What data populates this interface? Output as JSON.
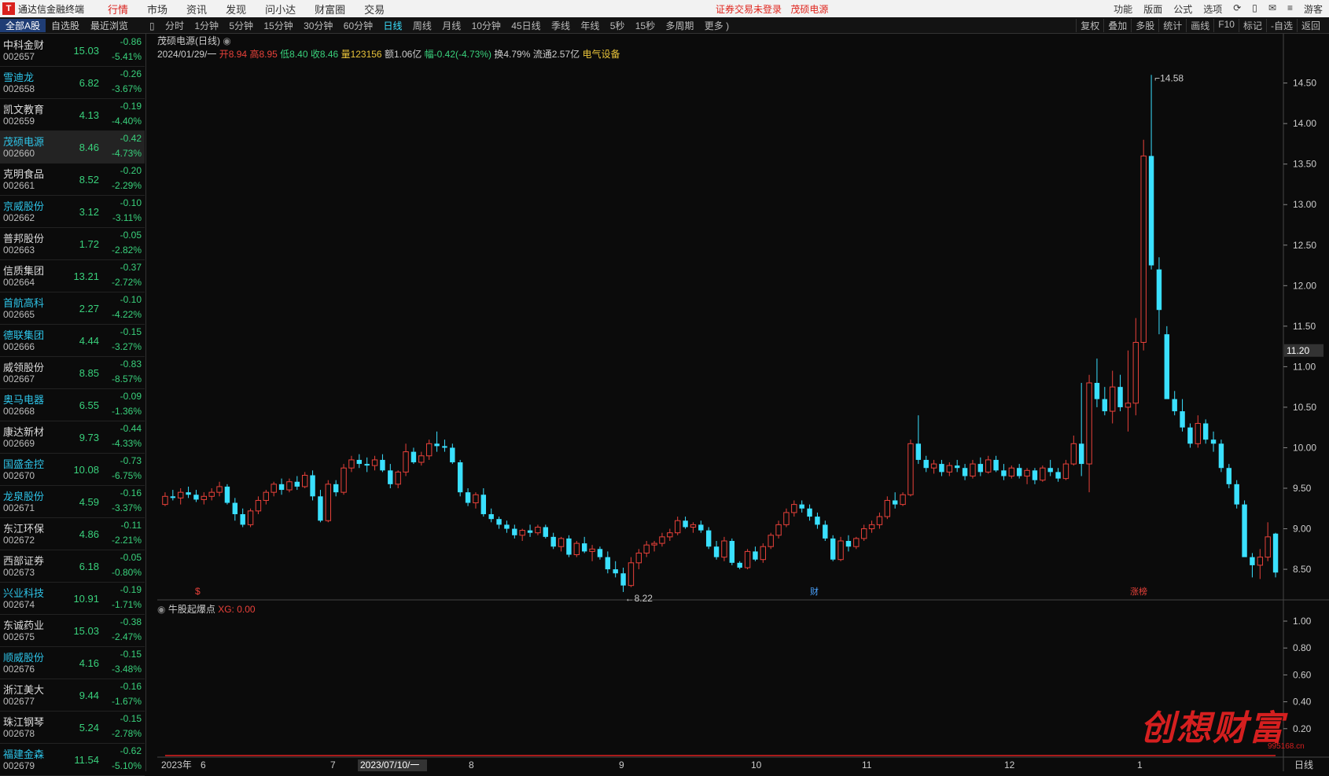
{
  "app": {
    "title": "通达信金融终端",
    "logo": "T"
  },
  "menu": [
    "行情",
    "市场",
    "资讯",
    "发现",
    "问小达",
    "财富圈",
    "交易"
  ],
  "notice": [
    "证券交易未登录",
    "茂硕电源"
  ],
  "topright": [
    "功能",
    "版面",
    "公式",
    "选项",
    "游客"
  ],
  "lefttabs": [
    "全部A股",
    "自选股",
    "最近浏览"
  ],
  "periods": [
    "分时",
    "1分钟",
    "5分钟",
    "15分钟",
    "30分钟",
    "60分钟",
    "日线",
    "周线",
    "月线",
    "10分钟",
    "45日线",
    "季线",
    "年线",
    "5秒",
    "15秒",
    "多周期",
    "更多 )"
  ],
  "righttools": [
    "复权",
    "叠加",
    "多股",
    "统计",
    "画线",
    "F10",
    "标记",
    "-自选",
    "返回"
  ],
  "stocks": [
    {
      "name": "中科金财",
      "code": "002657",
      "price": "15.03",
      "chg": "-0.86",
      "pct": "-5.41%",
      "blue": false
    },
    {
      "name": "雪迪龙",
      "code": "002658",
      "price": "6.82",
      "chg": "-0.26",
      "pct": "-3.67%",
      "blue": true
    },
    {
      "name": "凯文教育",
      "code": "002659",
      "price": "4.13",
      "chg": "-0.19",
      "pct": "-4.40%",
      "blue": false
    },
    {
      "name": "茂硕电源",
      "code": "002660",
      "price": "8.46",
      "chg": "-0.42",
      "pct": "-4.73%",
      "blue": true
    },
    {
      "name": "克明食品",
      "code": "002661",
      "price": "8.52",
      "chg": "-0.20",
      "pct": "-2.29%",
      "blue": false
    },
    {
      "name": "京威股份",
      "code": "002662",
      "price": "3.12",
      "chg": "-0.10",
      "pct": "-3.11%",
      "blue": true
    },
    {
      "name": "普邦股份",
      "code": "002663",
      "price": "1.72",
      "chg": "-0.05",
      "pct": "-2.82%",
      "blue": false
    },
    {
      "name": "信质集团",
      "code": "002664",
      "price": "13.21",
      "chg": "-0.37",
      "pct": "-2.72%",
      "blue": false
    },
    {
      "name": "首航高科",
      "code": "002665",
      "price": "2.27",
      "chg": "-0.10",
      "pct": "-4.22%",
      "blue": true
    },
    {
      "name": "德联集团",
      "code": "002666",
      "price": "4.44",
      "chg": "-0.15",
      "pct": "-3.27%",
      "blue": true
    },
    {
      "name": "威领股份",
      "code": "002667",
      "price": "8.85",
      "chg": "-0.83",
      "pct": "-8.57%",
      "blue": false
    },
    {
      "name": "奥马电器",
      "code": "002668",
      "price": "6.55",
      "chg": "-0.09",
      "pct": "-1.36%",
      "blue": true
    },
    {
      "name": "康达新材",
      "code": "002669",
      "price": "9.73",
      "chg": "-0.44",
      "pct": "-4.33%",
      "blue": false
    },
    {
      "name": "国盛金控",
      "code": "002670",
      "price": "10.08",
      "chg": "-0.73",
      "pct": "-6.75%",
      "blue": true
    },
    {
      "name": "龙泉股份",
      "code": "002671",
      "price": "4.59",
      "chg": "-0.16",
      "pct": "-3.37%",
      "blue": true
    },
    {
      "name": "东江环保",
      "code": "002672",
      "price": "4.86",
      "chg": "-0.11",
      "pct": "-2.21%",
      "blue": false
    },
    {
      "name": "西部证券",
      "code": "002673",
      "price": "6.18",
      "chg": "-0.05",
      "pct": "-0.80%",
      "blue": false
    },
    {
      "name": "兴业科技",
      "code": "002674",
      "price": "10.91",
      "chg": "-0.19",
      "pct": "-1.71%",
      "blue": true
    },
    {
      "name": "东诚药业",
      "code": "002675",
      "price": "15.03",
      "chg": "-0.38",
      "pct": "-2.47%",
      "blue": false
    },
    {
      "name": "顺威股份",
      "code": "002676",
      "price": "4.16",
      "chg": "-0.15",
      "pct": "-3.48%",
      "blue": true
    },
    {
      "name": "浙江美大",
      "code": "002677",
      "price": "9.44",
      "chg": "-0.16",
      "pct": "-1.67%",
      "blue": false
    },
    {
      "name": "珠江钢琴",
      "code": "002678",
      "price": "5.24",
      "chg": "-0.15",
      "pct": "-2.78%",
      "blue": false
    },
    {
      "name": "福建金森",
      "code": "002679",
      "price": "11.54",
      "chg": "-0.62",
      "pct": "-5.10%",
      "blue": true
    }
  ],
  "chart": {
    "title": "茂硕电源(日线)",
    "info": {
      "date": "2024/01/29/一",
      "open": "开8.94",
      "high": "高8.95",
      "low": "低8.40",
      "close": "收8.46",
      "vol": "量123156",
      "amt": "额1.06亿",
      "range": "幅-0.42(-4.73%)",
      "turn": "换4.79%",
      "float": "流通2.57亿",
      "sector": "电气设备"
    },
    "indicator": {
      "name": "牛股起爆点",
      "value": "XG: 0.00"
    },
    "high_label": "14.58",
    "low_label": "8.22",
    "cursor_price": "11.20",
    "markers": [
      "$",
      "财",
      "涨榜"
    ],
    "date_cursor": "2023/07/10/一"
  },
  "chart_data": {
    "type": "candlestick",
    "yticks": [
      "14.50",
      "14.00",
      "13.50",
      "13.00",
      "12.50",
      "12.00",
      "11.50",
      "11.00",
      "10.50",
      "10.00",
      "9.50",
      "9.00",
      "8.50"
    ],
    "ylim": [
      8.2,
      14.7
    ],
    "xlabels": [
      "2023年",
      "6",
      "7",
      "8",
      "9",
      "10",
      "11",
      "12",
      "1",
      "日线"
    ],
    "indicator_yticks": [
      "1.00",
      "0.80",
      "0.60",
      "0.40",
      "0.20"
    ],
    "indicator_values": [
      [
        171,
        1
      ],
      [
        177,
        1
      ],
      [
        197,
        1
      ]
    ],
    "ohlc": [
      [
        9.3,
        9.45,
        9.28,
        9.4
      ],
      [
        9.4,
        9.48,
        9.35,
        9.38
      ],
      [
        9.38,
        9.5,
        9.3,
        9.45
      ],
      [
        9.45,
        9.52,
        9.38,
        9.42
      ],
      [
        9.42,
        9.48,
        9.33,
        9.36
      ],
      [
        9.36,
        9.45,
        9.3,
        9.4
      ],
      [
        9.4,
        9.5,
        9.35,
        9.45
      ],
      [
        9.45,
        9.58,
        9.4,
        9.52
      ],
      [
        9.52,
        9.55,
        9.3,
        9.32
      ],
      [
        9.32,
        9.38,
        9.1,
        9.18
      ],
      [
        9.18,
        9.25,
        9.02,
        9.05
      ],
      [
        9.05,
        9.25,
        9.02,
        9.22
      ],
      [
        9.22,
        9.4,
        9.18,
        9.35
      ],
      [
        9.35,
        9.48,
        9.3,
        9.45
      ],
      [
        9.45,
        9.58,
        9.4,
        9.55
      ],
      [
        9.55,
        9.62,
        9.42,
        9.48
      ],
      [
        9.48,
        9.62,
        9.45,
        9.58
      ],
      [
        9.58,
        9.65,
        9.48,
        9.52
      ],
      [
        9.52,
        9.7,
        9.5,
        9.66
      ],
      [
        9.66,
        9.72,
        9.35,
        9.4
      ],
      [
        9.4,
        9.48,
        9.08,
        9.1
      ],
      [
        9.1,
        9.6,
        9.08,
        9.55
      ],
      [
        9.55,
        9.6,
        9.4,
        9.45
      ],
      [
        9.45,
        9.8,
        9.42,
        9.75
      ],
      [
        9.75,
        9.9,
        9.7,
        9.85
      ],
      [
        9.85,
        9.92,
        9.75,
        9.8
      ],
      [
        9.8,
        9.88,
        9.7,
        9.78
      ],
      [
        9.78,
        9.9,
        9.72,
        9.85
      ],
      [
        9.85,
        9.92,
        9.7,
        9.72
      ],
      [
        9.72,
        9.8,
        9.5,
        9.55
      ],
      [
        9.55,
        9.72,
        9.5,
        9.7
      ],
      [
        9.7,
        10.05,
        9.65,
        9.95
      ],
      [
        9.95,
        10.0,
        9.8,
        9.82
      ],
      [
        9.82,
        9.95,
        9.78,
        9.9
      ],
      [
        9.9,
        10.1,
        9.85,
        10.05
      ],
      [
        10.05,
        10.2,
        9.95,
        10.02
      ],
      [
        10.02,
        10.1,
        9.95,
        10.0
      ],
      [
        10.0,
        10.05,
        9.8,
        9.82
      ],
      [
        9.82,
        9.85,
        9.4,
        9.45
      ],
      [
        9.45,
        9.5,
        9.28,
        9.32
      ],
      [
        9.32,
        9.45,
        9.25,
        9.42
      ],
      [
        9.42,
        9.5,
        9.15,
        9.18
      ],
      [
        9.18,
        9.25,
        9.08,
        9.12
      ],
      [
        9.12,
        9.15,
        9.0,
        9.05
      ],
      [
        9.05,
        9.1,
        8.95,
        9.0
      ],
      [
        9.0,
        9.05,
        8.88,
        8.92
      ],
      [
        8.92,
        9.0,
        8.85,
        8.98
      ],
      [
        8.98,
        9.05,
        8.9,
        8.95
      ],
      [
        8.95,
        9.05,
        8.92,
        9.02
      ],
      [
        9.02,
        9.05,
        8.88,
        8.9
      ],
      [
        8.9,
        8.95,
        8.75,
        8.78
      ],
      [
        8.78,
        8.9,
        8.72,
        8.88
      ],
      [
        8.88,
        8.92,
        8.65,
        8.68
      ],
      [
        8.68,
        8.85,
        8.65,
        8.82
      ],
      [
        8.82,
        8.9,
        8.7,
        8.72
      ],
      [
        8.72,
        8.8,
        8.6,
        8.75
      ],
      [
        8.75,
        8.78,
        8.62,
        8.65
      ],
      [
        8.65,
        8.72,
        8.45,
        8.5
      ],
      [
        8.5,
        8.6,
        8.4,
        8.45
      ],
      [
        8.45,
        8.52,
        8.22,
        8.3
      ],
      [
        8.3,
        8.65,
        8.28,
        8.58
      ],
      [
        8.58,
        8.75,
        8.5,
        8.7
      ],
      [
        8.7,
        8.85,
        8.65,
        8.8
      ],
      [
        8.8,
        8.85,
        8.72,
        8.82
      ],
      [
        8.82,
        8.95,
        8.78,
        8.9
      ],
      [
        8.9,
        9.0,
        8.85,
        8.95
      ],
      [
        8.95,
        9.15,
        8.92,
        9.1
      ],
      [
        9.1,
        9.15,
        9.0,
        9.02
      ],
      [
        9.02,
        9.08,
        8.95,
        9.05
      ],
      [
        9.05,
        9.1,
        8.95,
        8.98
      ],
      [
        8.98,
        9.02,
        8.75,
        8.78
      ],
      [
        8.78,
        8.85,
        8.62,
        8.65
      ],
      [
        8.65,
        8.9,
        8.6,
        8.85
      ],
      [
        8.85,
        8.88,
        8.55,
        8.58
      ],
      [
        8.58,
        8.6,
        8.5,
        8.52
      ],
      [
        8.52,
        8.75,
        8.5,
        8.72
      ],
      [
        8.72,
        8.78,
        8.6,
        8.62
      ],
      [
        8.62,
        8.82,
        8.58,
        8.78
      ],
      [
        8.78,
        8.95,
        8.75,
        8.92
      ],
      [
        8.92,
        9.1,
        8.88,
        9.05
      ],
      [
        9.05,
        9.25,
        9.02,
        9.2
      ],
      [
        9.2,
        9.35,
        9.15,
        9.3
      ],
      [
        9.3,
        9.35,
        9.2,
        9.25
      ],
      [
        9.25,
        9.3,
        9.1,
        9.15
      ],
      [
        9.15,
        9.2,
        9.0,
        9.05
      ],
      [
        9.05,
        9.1,
        8.85,
        8.88
      ],
      [
        8.88,
        8.92,
        8.6,
        8.62
      ],
      [
        8.62,
        8.9,
        8.6,
        8.85
      ],
      [
        8.85,
        8.92,
        8.72,
        8.78
      ],
      [
        8.78,
        8.9,
        8.75,
        8.88
      ],
      [
        8.88,
        9.05,
        8.85,
        9.0
      ],
      [
        9.0,
        9.1,
        8.95,
        9.05
      ],
      [
        9.05,
        9.2,
        9.0,
        9.15
      ],
      [
        9.15,
        9.4,
        9.12,
        9.35
      ],
      [
        9.35,
        9.45,
        9.25,
        9.3
      ],
      [
        9.3,
        9.45,
        9.28,
        9.42
      ],
      [
        9.42,
        10.1,
        9.4,
        10.05
      ],
      [
        10.05,
        10.4,
        9.8,
        9.85
      ],
      [
        9.85,
        9.9,
        9.7,
        9.75
      ],
      [
        9.75,
        9.85,
        9.68,
        9.8
      ],
      [
        9.8,
        9.85,
        9.65,
        9.7
      ],
      [
        9.7,
        9.82,
        9.65,
        9.78
      ],
      [
        9.78,
        9.85,
        9.7,
        9.75
      ],
      [
        9.75,
        9.8,
        9.6,
        9.65
      ],
      [
        9.65,
        9.85,
        9.62,
        9.8
      ],
      [
        9.8,
        9.88,
        9.65,
        9.7
      ],
      [
        9.7,
        9.9,
        9.68,
        9.85
      ],
      [
        9.85,
        9.9,
        9.7,
        9.72
      ],
      [
        9.72,
        9.8,
        9.6,
        9.65
      ],
      [
        9.65,
        9.78,
        9.62,
        9.75
      ],
      [
        9.75,
        9.8,
        9.62,
        9.65
      ],
      [
        9.65,
        9.75,
        9.55,
        9.72
      ],
      [
        9.72,
        9.75,
        9.55,
        9.6
      ],
      [
        9.6,
        9.78,
        9.58,
        9.75
      ],
      [
        9.75,
        9.85,
        9.65,
        9.7
      ],
      [
        9.7,
        9.75,
        9.58,
        9.62
      ],
      [
        9.62,
        9.85,
        9.6,
        9.8
      ],
      [
        9.8,
        10.15,
        9.78,
        10.05
      ],
      [
        10.05,
        10.8,
        9.65,
        9.8
      ],
      [
        9.8,
        10.9,
        9.45,
        10.8
      ],
      [
        10.8,
        11.1,
        10.5,
        10.6
      ],
      [
        10.6,
        10.75,
        10.4,
        10.45
      ],
      [
        10.45,
        10.95,
        10.3,
        10.75
      ],
      [
        10.75,
        10.9,
        10.45,
        10.5
      ],
      [
        10.5,
        11.2,
        10.2,
        10.55
      ],
      [
        10.55,
        11.6,
        10.4,
        11.3
      ],
      [
        11.3,
        13.8,
        11.2,
        13.6
      ],
      [
        13.6,
        14.6,
        12.2,
        12.25
      ],
      [
        12.2,
        12.35,
        11.4,
        11.7
      ],
      [
        11.4,
        11.5,
        10.8,
        10.6
      ],
      [
        10.6,
        10.7,
        10.4,
        10.45
      ],
      [
        10.45,
        10.6,
        10.2,
        10.25
      ],
      [
        10.25,
        10.3,
        10.0,
        10.05
      ],
      [
        10.05,
        10.4,
        10.0,
        10.3
      ],
      [
        10.3,
        10.35,
        10.05,
        10.1
      ],
      [
        10.1,
        10.2,
        9.95,
        10.05
      ],
      [
        10.05,
        10.1,
        9.7,
        9.75
      ],
      [
        9.75,
        9.8,
        9.5,
        9.55
      ],
      [
        9.55,
        9.6,
        9.25,
        9.3
      ],
      [
        9.3,
        9.35,
        8.75,
        8.65
      ],
      [
        8.65,
        8.7,
        8.4,
        8.55
      ],
      [
        8.55,
        8.75,
        8.38,
        8.65
      ],
      [
        8.65,
        9.08,
        8.6,
        8.9
      ],
      [
        8.94,
        8.95,
        8.4,
        8.46
      ]
    ]
  }
}
